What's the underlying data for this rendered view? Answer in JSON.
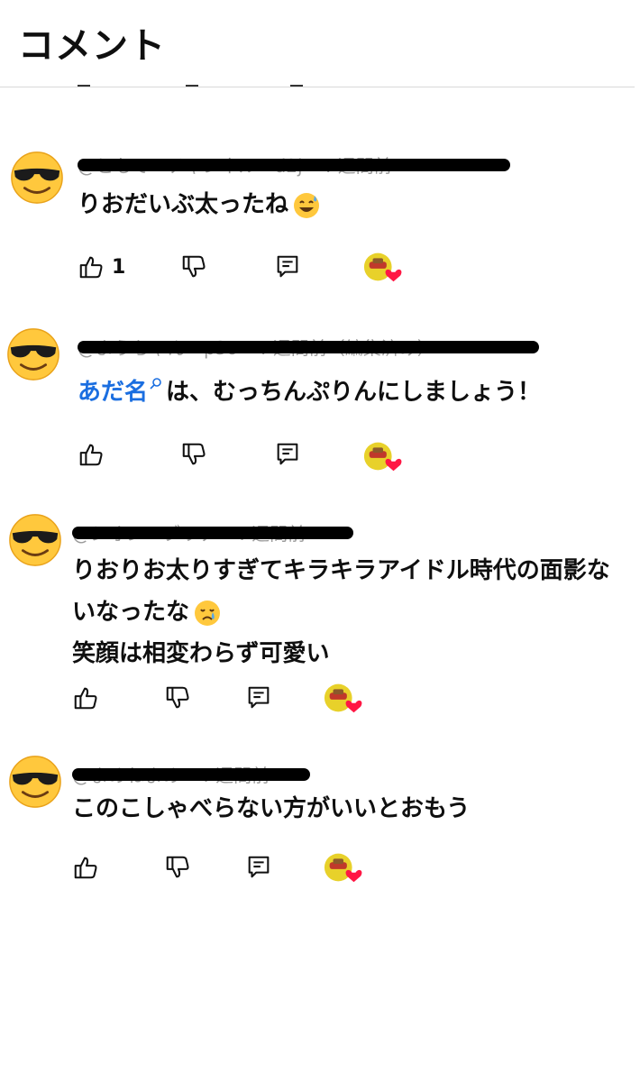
{
  "header": {
    "title": "コメント"
  },
  "comments": [
    {
      "author": "@ともで　チャンネル　d2j　4 週間前",
      "text_lines": [
        "りおだいぶ太ったね"
      ],
      "like_count": "1"
    },
    {
      "author": "@ようちゃん　p3o　4 週間前（編集済み）",
      "mention": "あだ名",
      "text_lines": [
        "は、むっちんぷりんにしましょう！"
      ],
      "like_count": ""
    },
    {
      "author": "@シオン　ブリテ　4 週間前",
      "text_lines": [
        "りおりお太りすぎてキラキラアイドル時代の面影な",
        "いなったな",
        "笑顔は相変わらず可愛い"
      ],
      "like_count": ""
    },
    {
      "author": "@まめねまめ　4 週間前",
      "text_lines": [
        "このこしゃべらない方がいいとおもう"
      ],
      "like_count": ""
    }
  ],
  "icons": {
    "avatar": "sunglasses-emoji-icon",
    "like": "thumbs-up-icon",
    "dislike": "thumbs-down-icon",
    "reply": "reply-comment-icon",
    "creator_heart": "creator-heart-icon",
    "search": "search-icon",
    "sweat_smile": "sweat-smile-emoji-icon",
    "crying": "crying-emoji-icon"
  },
  "colors": {
    "mention": "#1a6ee0",
    "heart": "#ff1744",
    "redaction": "#000000"
  }
}
